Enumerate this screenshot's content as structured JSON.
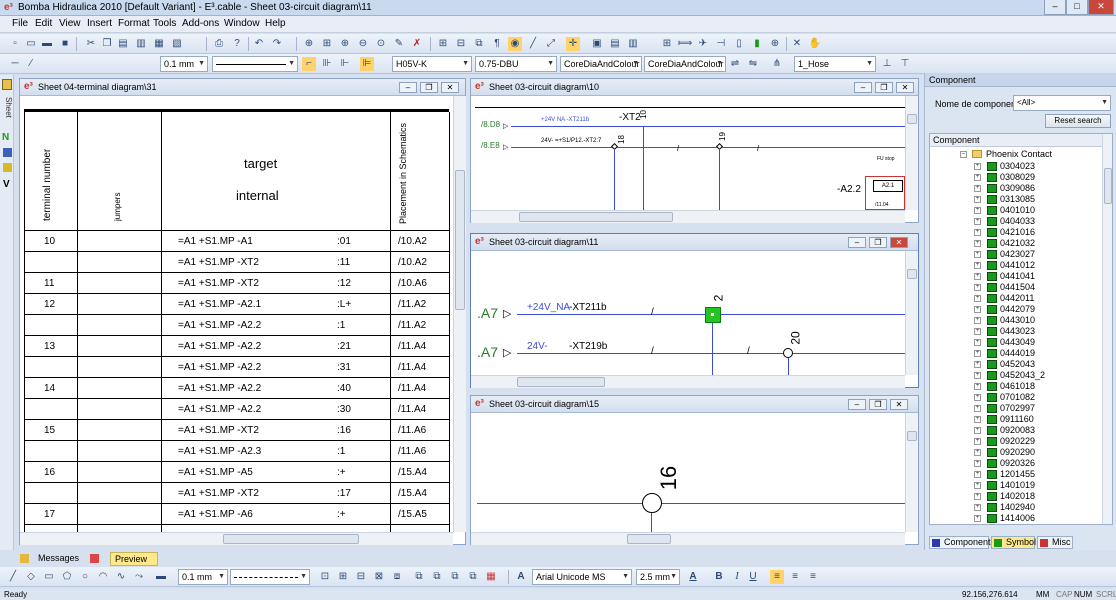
{
  "app": {
    "title": "Bomba Hidraulica 2010 [Default Variant] - E³.cable - Sheet 03-circuit diagram\\11",
    "minimize": "–",
    "maximize": "□",
    "close": "✕"
  },
  "menu": [
    "File",
    "Edit",
    "View",
    "Insert",
    "Format",
    "Tools",
    "Add-ons",
    "Window",
    "Help"
  ],
  "toolbar2": {
    "line_width": "0.1 mm",
    "wire_type": "H05V-K",
    "cross_section": "0.75-DBU",
    "color1": "CoreDiaAndColour",
    "color2": "CoreDiaAndColour",
    "hose": "1_Hose"
  },
  "left_tab": "Sheet",
  "terminal": {
    "title": "Sheet 04-terminal diagram\\31",
    "headers": {
      "number": "terminal number",
      "jumpers": "jumpers",
      "target_top": "target",
      "target_bottom": "internal",
      "placement": "Placement in Schematics"
    },
    "rows": [
      {
        "n": "10",
        "t": "=A1 +S1.MP -A1",
        "p": ":01",
        "s": "/10.A2"
      },
      {
        "n": "",
        "t": "=A1 +S1.MP -XT2",
        "p": ":11",
        "s": "/10.A2"
      },
      {
        "n": "11",
        "t": "=A1 +S1.MP -XT2",
        "p": ":12",
        "s": "/10.A6"
      },
      {
        "n": "12",
        "t": "=A1 +S1.MP -A2.1",
        "p": ":L+",
        "s": "/11.A2"
      },
      {
        "n": "",
        "t": "=A1 +S1.MP -A2.2",
        "p": ":1",
        "s": "/11.A2"
      },
      {
        "n": "13",
        "t": "=A1 +S1.MP -A2.2",
        "p": ":21",
        "s": "/11.A4"
      },
      {
        "n": "",
        "t": "=A1 +S1.MP -A2.2",
        "p": ":31",
        "s": "/11.A4"
      },
      {
        "n": "14",
        "t": "=A1 +S1.MP -A2.2",
        "p": ":40",
        "s": "/11.A4"
      },
      {
        "n": "",
        "t": "=A1 +S1.MP -A2.2",
        "p": ":30",
        "s": "/11.A4"
      },
      {
        "n": "15",
        "t": "=A1 +S1.MP -XT2",
        "p": ":16",
        "s": "/11.A6"
      },
      {
        "n": "",
        "t": "=A1 +S1.MP -A2.3",
        "p": ":1",
        "s": "/11.A6"
      },
      {
        "n": "16",
        "t": "=A1 +S1.MP -A5",
        "p": ":+",
        "s": "/15.A4"
      },
      {
        "n": "",
        "t": "=A1 +S1.MP -XT2",
        "p": ":17",
        "s": "/15.A4"
      },
      {
        "n": "17",
        "t": "=A1 +S1.MP -A6",
        "p": ":+",
        "s": "/15.A5"
      },
      {
        "n": "",
        "t": "",
        "p": "",
        "s": ""
      }
    ]
  },
  "circ10": {
    "title": "Sheet 03-circuit diagram\\10",
    "ref1": "/8.D8",
    "ref2": "/8.E8",
    "sig1": "+24V NA  -XT211b",
    "sig2": "24V-  =+S1/P12.-XT2:7",
    "xt2": "-XT2",
    "n10": "10",
    "n18": "18",
    "n19": "19",
    "a22": "-A2.2",
    "a21": "A2.1",
    "fu": "FU stop",
    "ref3": "/11.04"
  },
  "circ11": {
    "title": "Sheet 03-circuit diagram\\11",
    "a7a": ".A7",
    "a7b": ".A7",
    "sigA": "+24V_NA",
    "xtA": "-XT211b",
    "sigB": "24V-",
    "xtB": "-XT219b",
    "n2": "2",
    "n20": "20"
  },
  "circ15": {
    "title": "Sheet 03-circuit diagram\\15",
    "n16": "16"
  },
  "component": {
    "header": "Component",
    "label": "Nome de componente",
    "filter": "<All>",
    "reset": "Reset search",
    "tree_header": "Component",
    "root": "Phoenix Contact",
    "items": [
      "0304023",
      "0308029",
      "0309086",
      "0313085",
      "0401010",
      "0404033",
      "0421016",
      "0421032",
      "0423027",
      "0441012",
      "0441041",
      "0441504",
      "0442011",
      "0442079",
      "0443010",
      "0443023",
      "0443049",
      "0444019",
      "0452043",
      "0452043_2",
      "0461018",
      "0701082",
      "0702997",
      "0911160",
      "0920083",
      "0920229",
      "0920290",
      "0920326",
      "1201455",
      "1401019",
      "1402018",
      "1402940",
      "1414006"
    ],
    "tabs": [
      "Component",
      "Symbol",
      "Misc"
    ]
  },
  "bottom_tabs": [
    "Messages",
    "Preview"
  ],
  "format_bar": {
    "line_width": "0.1 mm",
    "font": "Arial Unicode MS",
    "size": "2.5 mm"
  },
  "status": {
    "ready": "Ready",
    "coords": "92.156,276.614",
    "mm": "MM",
    "cap": "CAP",
    "num": "NUM",
    "scrl": "SCRL"
  },
  "colors": {
    "wire": "#3d4cd6",
    "accent": "#1a9a1a"
  }
}
